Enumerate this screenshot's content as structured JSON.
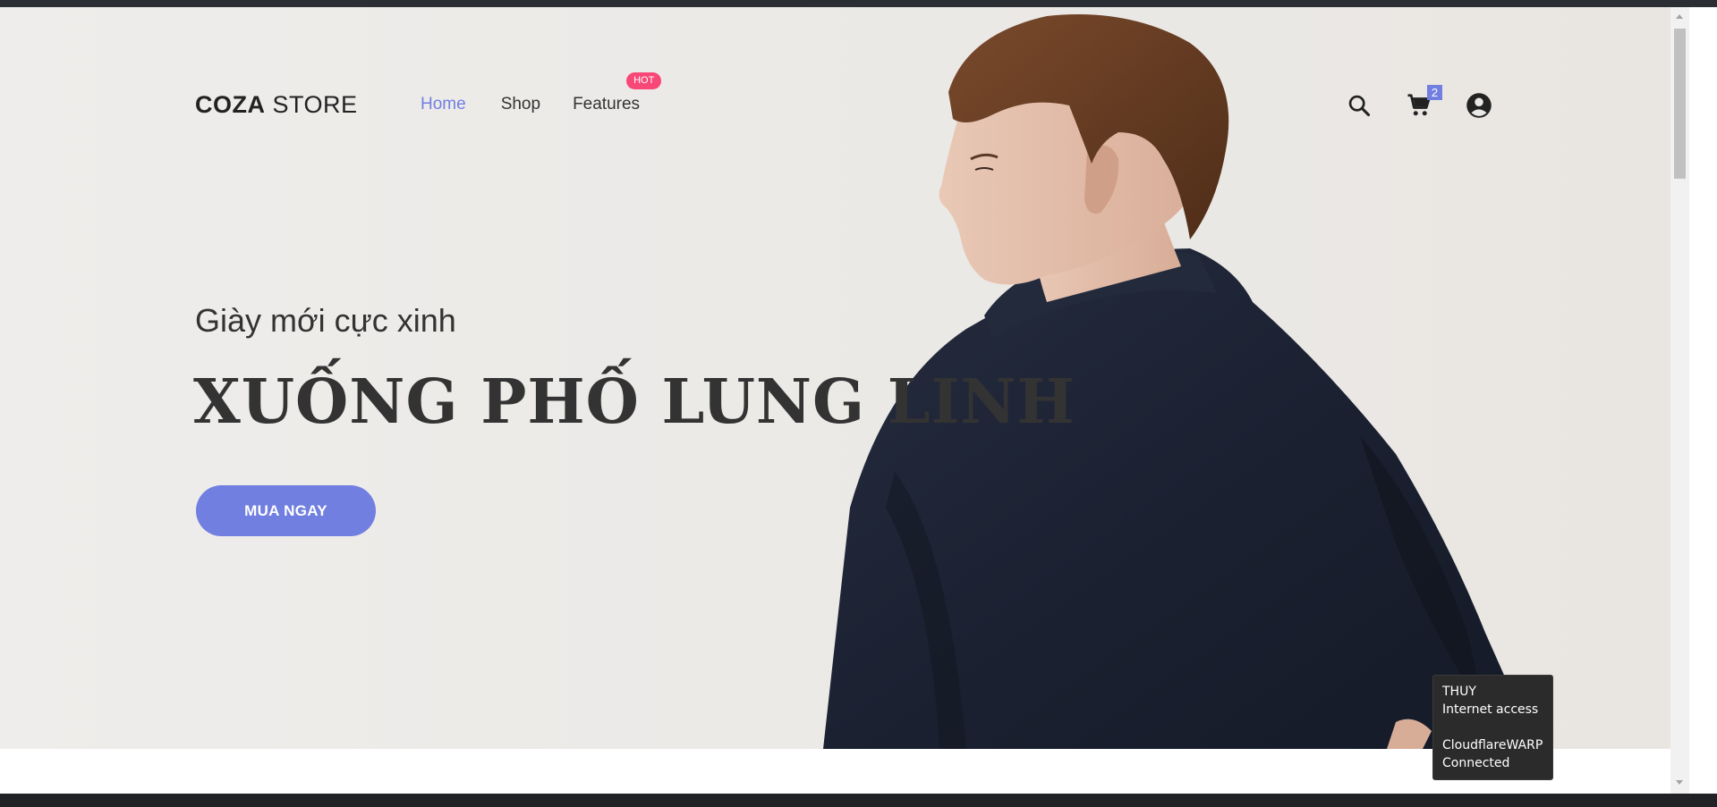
{
  "brand": {
    "logo_bold": "COZA",
    "logo_light": " STORE"
  },
  "nav": {
    "items": [
      {
        "label": "Home",
        "active": true
      },
      {
        "label": "Shop",
        "active": false
      },
      {
        "label": "Features",
        "active": false,
        "badge": "HOT"
      }
    ]
  },
  "header_icons": {
    "search": "search-icon",
    "cart": "cart-icon",
    "account": "account-icon",
    "cart_count": "2"
  },
  "hero": {
    "subtitle": "Giày mới cực xinh",
    "headline": "XUỐNG PHỐ LUNG LINH",
    "cta_label": "MUA NGAY"
  },
  "network_tooltip": {
    "line1": "THUY",
    "line2": "Internet access",
    "line3": "CloudflareWARP",
    "line4": "Connected"
  },
  "colors": {
    "accent": "#717fe0",
    "hot_badge": "#f74877",
    "text_dark": "#333333",
    "hero_bg": "#ebe9e6",
    "jacket": "#1c2233"
  }
}
